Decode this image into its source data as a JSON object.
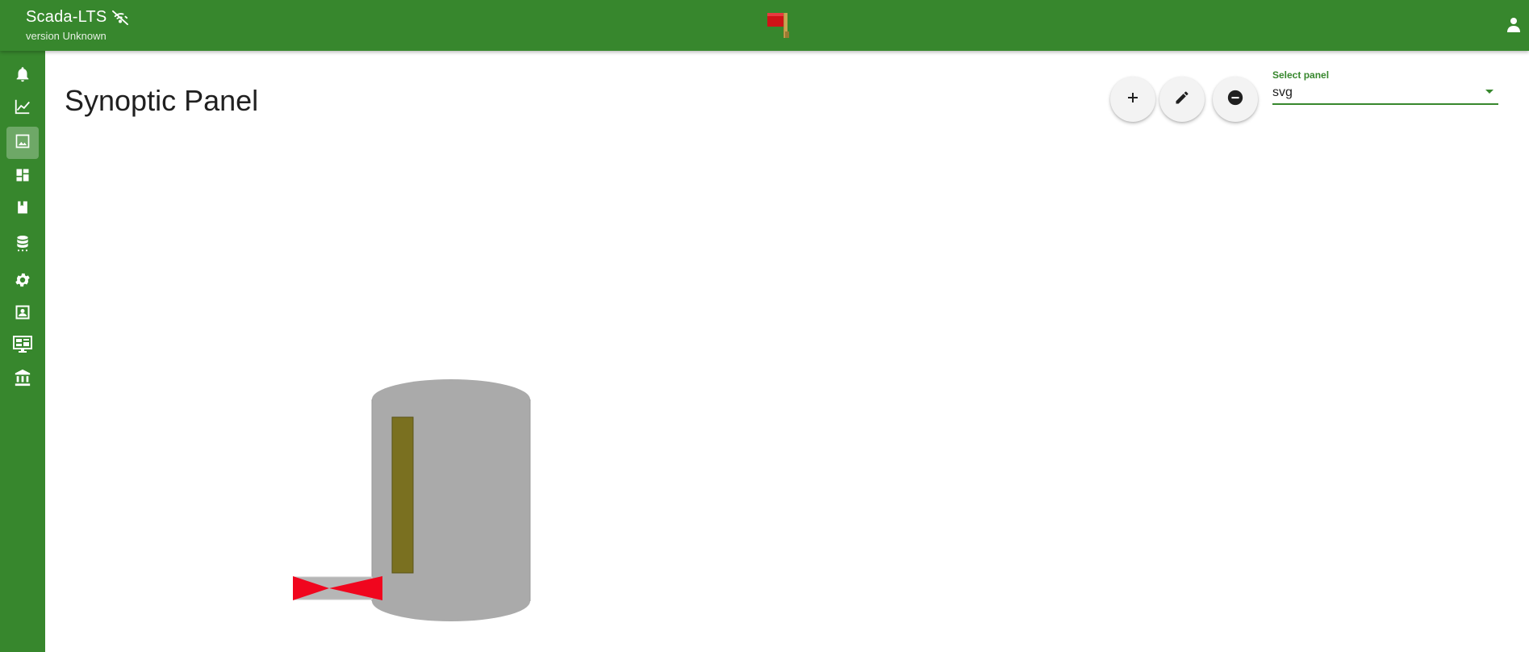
{
  "header": {
    "app_name": "Scada-LTS",
    "version": "version Unknown",
    "connection_icon": "wifi-off-icon",
    "alarm_icon": "red-flag-icon",
    "user_icon": "account-icon"
  },
  "sidebar": {
    "items": [
      {
        "icon": "bell-icon",
        "active": false
      },
      {
        "icon": "chart-line-icon",
        "active": false
      },
      {
        "icon": "image-icon",
        "active": true
      },
      {
        "icon": "dashboard-icon",
        "active": false
      },
      {
        "icon": "bookmark-icon",
        "active": false
      },
      {
        "icon": "database-icon",
        "active": false
      },
      {
        "icon": "gear-icon",
        "active": false
      },
      {
        "icon": "account-box-icon",
        "active": false
      },
      {
        "icon": "monitor-dashboard-icon",
        "active": false
      },
      {
        "icon": "bank-icon",
        "active": false
      }
    ]
  },
  "main": {
    "title": "Synoptic Panel",
    "actions": [
      {
        "icon": "plus-icon"
      },
      {
        "icon": "pencil-icon"
      },
      {
        "icon": "minus-circle-icon"
      }
    ],
    "select": {
      "label": "Select panel",
      "value": "svg"
    }
  },
  "synoptic": {
    "tank_color": "#aaaaaa",
    "level_color": "#7a7020",
    "valve_color": "#f0061e"
  },
  "colors": {
    "primary": "#37872d"
  }
}
